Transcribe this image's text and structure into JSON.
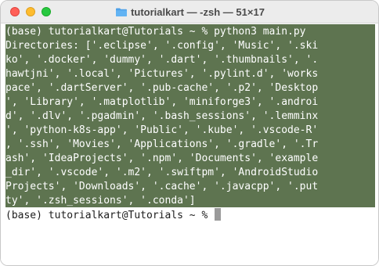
{
  "window": {
    "title": "tutorialkart — -zsh — 51×17",
    "folder_icon": "folder-icon"
  },
  "terminal": {
    "prompt_command": "(base) tutorialkart@Tutorials ~ % python3 main.py",
    "output_lines": [
      "Directories: ['.eclipse', '.config', 'Music', '.ski",
      "ko', '.docker', 'dummy', '.dart', '.thumbnails', '.",
      "hawtjni', '.local', 'Pictures', '.pylint.d', 'works",
      "pace', '.dartServer', '.pub-cache', '.p2', 'Desktop",
      "', 'Library', '.matplotlib', 'miniforge3', '.androi",
      "d', '.dlv', '.pgadmin', '.bash_sessions', '.lemminx",
      "', 'python-k8s-app', 'Public', '.kube', '.vscode-R'",
      ", '.ssh', 'Movies', 'Applications', '.gradle', '.Tr",
      "ash', 'IdeaProjects', '.npm', 'Documents', 'example",
      "_dir', '.vscode', '.m2', '.swiftpm', 'AndroidStudio",
      "Projects', 'Downloads', '.cache', '.javacpp', '.put",
      "ty', '.zsh_sessions', '.conda']"
    ],
    "final_prompt": "(base) tutorialkart@Tutorials ~ % "
  },
  "colors": {
    "selection": "#5e7450",
    "close": "#ff5f57",
    "minimize": "#febc2e",
    "maximize": "#28c840"
  }
}
